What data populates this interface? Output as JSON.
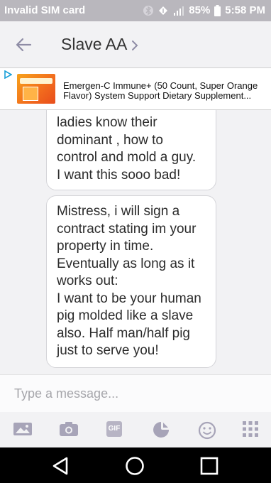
{
  "status": {
    "carrier": "Invalid SIM card",
    "battery": "85%",
    "time": "5:58 PM"
  },
  "header": {
    "contact_name": "Slave AA",
    "back_icon": "arrow-left-icon",
    "chevron_icon": "chevron-right-icon"
  },
  "ad": {
    "text": "Emergen-C Immune+ (50 Count, Super Orange Flavor) System Support Dietary Supplement..."
  },
  "messages": [
    {
      "lines": [
        "ladies know their",
        "dominant , how to",
        "control and mold a guy.",
        "I want this sooo bad!"
      ]
    },
    {
      "lines": [
        "Mistress, i will sign a",
        "contract stating im your",
        "property in time.",
        "Eventually as long as it",
        "works out:",
        "I want to be your human",
        "pig molded like a slave",
        "also. Half man/half pig",
        "just to serve you!"
      ]
    }
  ],
  "compose": {
    "placeholder": "Type a message..."
  },
  "toolbar": {
    "icons": [
      "image-icon",
      "camera-icon",
      "gif-icon",
      "sticker-icon",
      "emoji-icon",
      "apps-grid-icon"
    ],
    "gif_label": "GIF"
  },
  "colors": {
    "status_bar": "#b9b7bd",
    "accent": "#7d7a9a",
    "background": "#f2f2f4"
  }
}
